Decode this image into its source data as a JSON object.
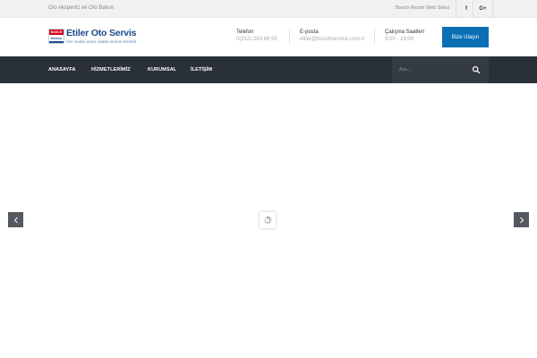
{
  "topbar": {
    "tagline": "Oto ekspertiz ve Oto Bakım",
    "official_site": "Bosch Resmi Web Sitesi",
    "social": [
      {
        "icon": "facebook-icon",
        "glyph": "f"
      },
      {
        "icon": "google-plus-icon",
        "glyph": "G+"
      }
    ]
  },
  "logo": {
    "badge_top": "BOSCH",
    "badge_bottom": "Service",
    "name_part1": "Etiler",
    "name_part2": "Oto Servis",
    "slogan": "Her marka araca, bütün onarım hizmeti"
  },
  "contact": {
    "phone_label": "Telefon",
    "phone_value": "0(212) 263 66 55",
    "email_label": "E-posta",
    "email_value": "etiler@boschservice.com.tr",
    "hours_label": "Çalışma Saatleri",
    "hours_value": "9:00 - 18:00"
  },
  "cta_label": "Bize Ulaşın",
  "nav": {
    "items": [
      "ANASAYFA",
      "HİZMETLERİMİZ",
      "KURUMSAL",
      "İLETİŞİM"
    ]
  },
  "search": {
    "placeholder": "Ara..."
  },
  "colors": {
    "accent": "#0b6fb5",
    "nav_bg": "#2a3038",
    "brand_blue": "#1c4a8c",
    "bosch_red": "#d0021b"
  }
}
